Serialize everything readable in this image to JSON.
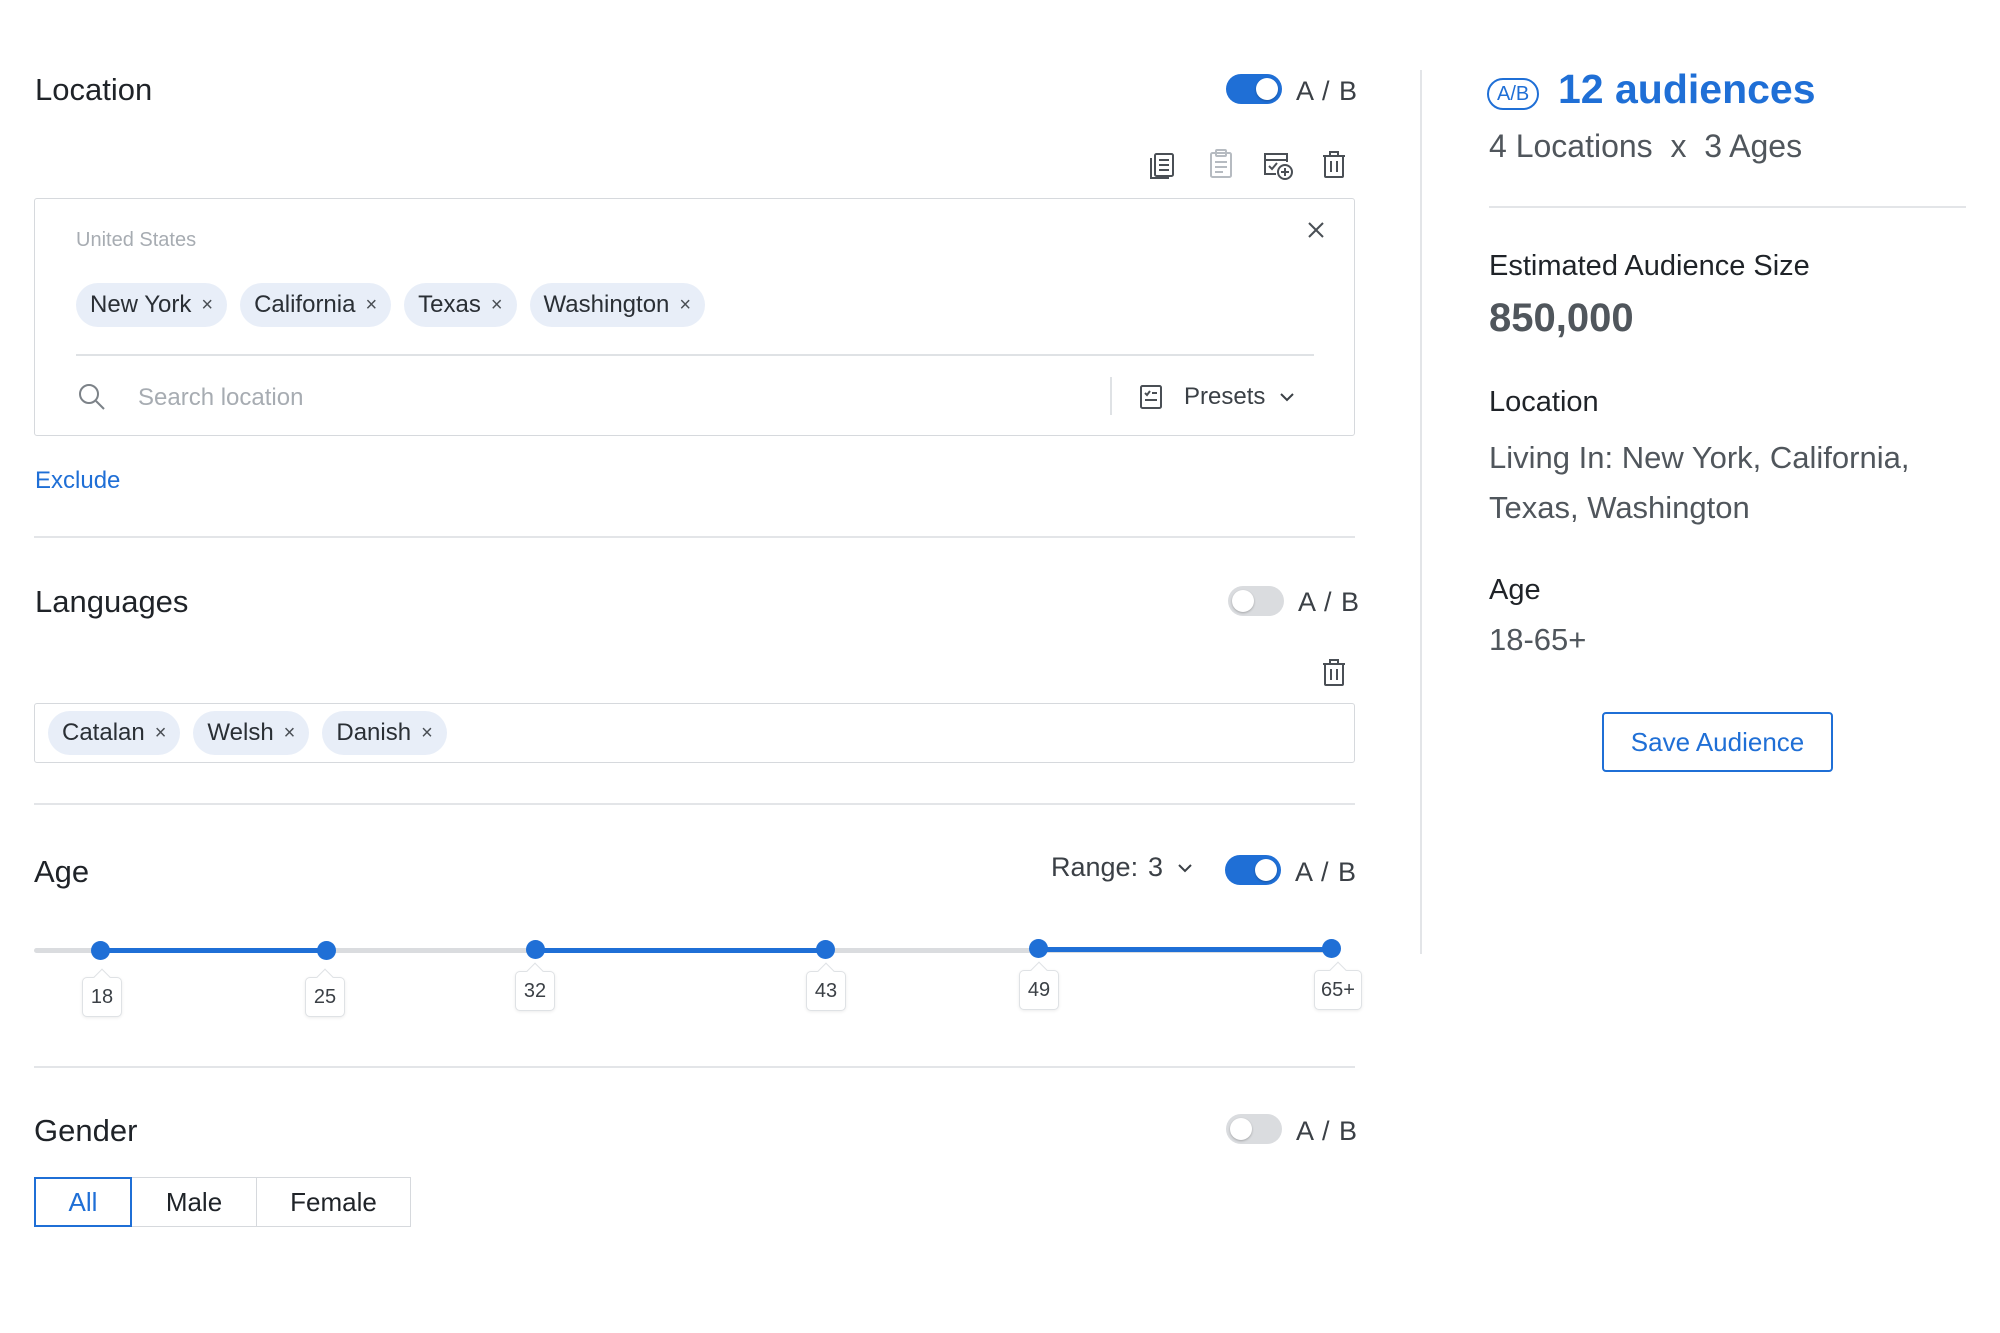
{
  "colors": {
    "accent": "#1f6fd6",
    "chip_bg": "#e8eef8",
    "muted": "#a7acb2"
  },
  "location": {
    "title": "Location",
    "ab_label": "A / B",
    "ab_enabled": true,
    "toolbar_icons": [
      "copy-icon",
      "paste-icon",
      "add-from-calendar-icon",
      "trash-icon"
    ],
    "country_hint": "United States",
    "chips": [
      {
        "label": "New York"
      },
      {
        "label": "California"
      },
      {
        "label": "Texas"
      },
      {
        "label": "Washington"
      }
    ],
    "search_placeholder": "Search location",
    "presets_label": "Presets",
    "exclude_label": "Exclude"
  },
  "languages": {
    "title": "Languages",
    "ab_label": "A / B",
    "ab_enabled": false,
    "chips": [
      {
        "label": "Catalan"
      },
      {
        "label": "Welsh"
      },
      {
        "label": "Danish"
      }
    ]
  },
  "age": {
    "title": "Age",
    "range_label": "Range:",
    "range_value": "3",
    "ab_label": "A / B",
    "ab_enabled": true,
    "ticks": [
      "18",
      "25",
      "32",
      "43",
      "49",
      "65+"
    ],
    "ranges": [
      [
        "18",
        "25"
      ],
      [
        "32",
        "43"
      ],
      [
        "49",
        "65+"
      ]
    ]
  },
  "gender": {
    "title": "Gender",
    "ab_label": "A / B",
    "ab_enabled": false,
    "options": [
      "All",
      "Male",
      "Female"
    ],
    "selected": "All"
  },
  "summary": {
    "ab_badge": "A/B",
    "audiences": "12 audiences",
    "formula": "4 Locations  x  3 Ages",
    "size_label": "Estimated Audience Size",
    "size_value": "850,000",
    "location_label": "Location",
    "location_value": "Living In: New York, California, Texas, Washington",
    "age_label": "Age",
    "age_value": "18-65+",
    "save_label": "Save Audience"
  }
}
